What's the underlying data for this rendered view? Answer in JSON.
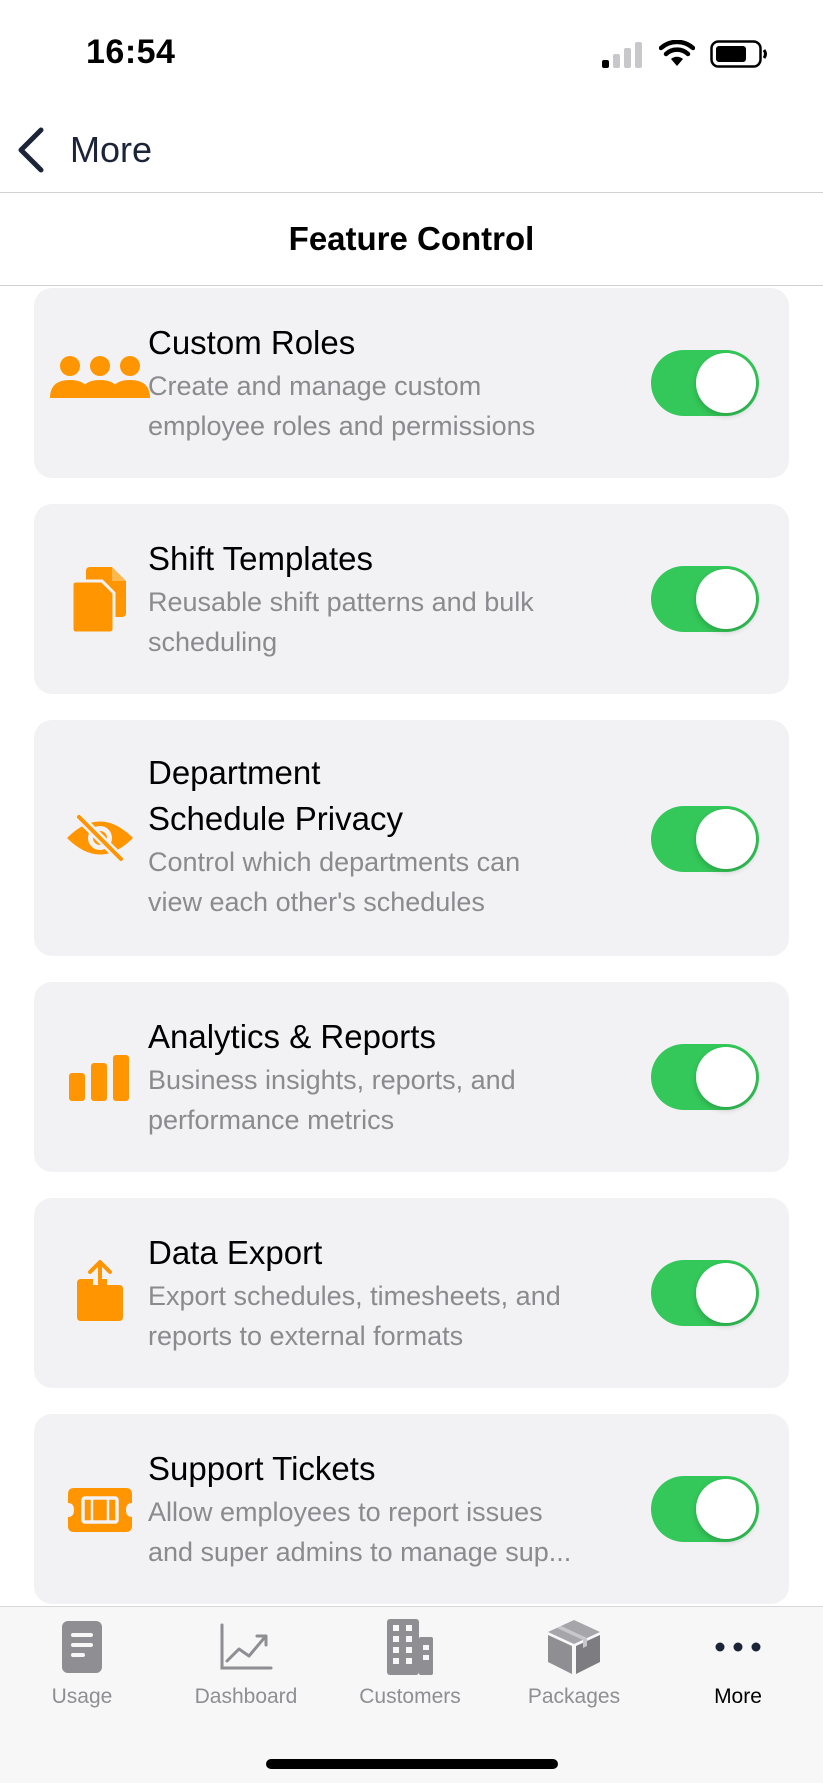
{
  "status_bar": {
    "time": "16:54",
    "icons": [
      "cellular-signal-icon",
      "wifi-icon",
      "battery-icon"
    ]
  },
  "nav": {
    "back_label": "More",
    "title": "Feature Control"
  },
  "colors": {
    "accent_orange": "#ff9500",
    "toggle_on": "#34c759",
    "card_bg": "#f2f2f5",
    "description_gray": "#8a8a8f"
  },
  "features": [
    {
      "title": "Custom Roles",
      "description": "Create and manage custom employee roles and permissions",
      "icon": "people-group-icon",
      "enabled": true
    },
    {
      "title": "Shift Templates",
      "description": "Reusable shift patterns and bulk scheduling",
      "icon": "copy-documents-icon",
      "enabled": true
    },
    {
      "title_line1": "Department",
      "title_line2": "Schedule Privacy",
      "description": "Control which departments can view each other's schedules",
      "icon": "eye-slash-icon",
      "enabled": true
    },
    {
      "title": "Analytics & Reports",
      "description": "Business insights, reports, and performance metrics",
      "icon": "bar-chart-icon",
      "enabled": true
    },
    {
      "title": "Data Export",
      "description": "Export schedules, timesheets, and reports to external formats",
      "icon": "share-export-icon",
      "enabled": true
    },
    {
      "title": "Support Tickets",
      "description_line1": "Allow employees to report issues",
      "description_line2": "and super admins to manage sup...",
      "icon": "ticket-icon",
      "enabled": true
    }
  ],
  "tab_bar": {
    "tabs": [
      {
        "label": "Usage",
        "icon": "document-icon",
        "active": false
      },
      {
        "label": "Dashboard",
        "icon": "line-chart-icon",
        "active": false
      },
      {
        "label": "Customers",
        "icon": "building-icon",
        "active": false
      },
      {
        "label": "Packages",
        "icon": "package-box-icon",
        "active": false
      },
      {
        "label": "More",
        "icon": "ellipsis-icon",
        "active": true
      }
    ]
  }
}
